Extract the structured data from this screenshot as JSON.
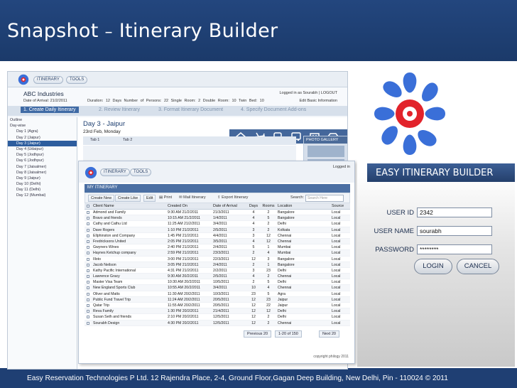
{
  "slide": {
    "title_prefix": "Snapshot",
    "title_dash": "–",
    "title_main": "Itinerary Builder",
    "footer": "Easy Reservation Technologies P Ltd. 12 Rajendra Place, 2-4, Ground Floor,Gagan Deep Building, New Delhi, Pin - 110024 © 2011"
  },
  "builder": {
    "menu": [
      "ITINERARY",
      "TOOLS"
    ],
    "company": "ABC Industries",
    "date_of_arrival": "Date of Arrival: 21/2/2011",
    "trip_info": "Duration: 12 Days   Number of Persons: 22   Single Room: 2   Double Room: 10   Twin Bed: 10",
    "logged_in": "Logged in as Sourabh | LOGOUT",
    "edit_basic": "Edit Basic Information",
    "steps": [
      "1. Create Daily Itinerary",
      "2. Review Itinerary",
      "3. Format Itinerary Document",
      "4. Specify Document Add-ons"
    ],
    "outline": [
      "Outline",
      "Day-wise",
      "Day 1 (Agra)",
      "Day 2 (Jaipur)",
      "Day 3 (Jaipur)",
      "Day 4 (Udaipur)",
      "Day 5 (Jodhpur)",
      "Day 6 (Jodhpur)",
      "Day 7 (Jaisalmer)",
      "Day 8 (Jaisalmer)",
      "Day 9 (Jaipur)",
      "Day 10 (Delhi)",
      "Day 11 (Delhi)",
      "Day 12 (Mumbai)"
    ],
    "day_title": "Day 3 - Jaipur",
    "day_date": "23rd Feb, Monday",
    "tabs": [
      "Tab 1",
      "Tab 2"
    ],
    "photo_gallery": "PHOTO GALLERY"
  },
  "list_window": {
    "menu": [
      "ITINERARY",
      "TOOLS"
    ],
    "logged_in": "Logged in",
    "header": "MY ITINERARY",
    "toolbar": [
      "Create New",
      "Create Like",
      "Edit"
    ],
    "links": [
      "Print",
      "Mail Itinerary",
      "Export Itinerary"
    ],
    "search_label": "Search:",
    "search_placeholder": "Search Here",
    "columns": [
      "Client Name",
      "Created On",
      "Date of Arrival",
      "Days",
      "Rooms",
      "Location",
      "Source"
    ],
    "rows": [
      [
        "Admond and Family",
        "9:30 AM 21/2/2011",
        "21/3/2011",
        "4",
        "2",
        "Bangalore",
        "Local"
      ],
      [
        "Bravo and friends",
        "10:15 AM 21/2/2011",
        "1/4/2011",
        "4",
        "5",
        "Bangalore",
        "Local"
      ],
      [
        "Cathy and Cathu Ltd",
        "11:25 AM 21/2/2011",
        "3/4/2011",
        "4",
        "2",
        "Delhi",
        "Local"
      ],
      [
        "Dave Rogers",
        "1:10 PM 21/2/2011",
        "2/5/2011",
        "3",
        "2",
        "Kolkata",
        "Local"
      ],
      [
        "Ellphinston and Company",
        "1:45 PM 21/2/2011",
        "4/4/2011",
        "3",
        "12",
        "Chennai",
        "Local"
      ],
      [
        "Fredricksons United",
        "2:05 PM 21/2/2011",
        "3/5/2011",
        "4",
        "12",
        "Chennai",
        "Local"
      ],
      [
        "Gwyners Wines",
        "2:40 PM 21/2/2011",
        "2/4/2011",
        "5",
        "1",
        "Mumbai",
        "Local"
      ],
      [
        "Haynes Ketchup company",
        "2:59 PM 21/2/2011",
        "23/3/2011",
        "2",
        "4",
        "Mumbai",
        "Local"
      ],
      [
        "Illoto",
        "3:00 PM 21/2/2011",
        "22/3/2011",
        "12",
        "3",
        "Bangalore",
        "Local"
      ],
      [
        "Jacob Neilson",
        "3:05 PM 21/2/2011",
        "2/4/2011",
        "2",
        "1",
        "Bangalore",
        "Local"
      ],
      [
        "Kathy Pacific International",
        "4:31 PM 21/2/2011",
        "2/2/2011",
        "3",
        "23",
        "Delhi",
        "Local"
      ],
      [
        "Lawrence Gracy",
        "9:30 AM 20/2/2011",
        "2/5/2011",
        "4",
        "2",
        "Chennai",
        "Local"
      ],
      [
        "Master Visa Team",
        "10:30 AM 20/2/2011",
        "10/5/2011",
        "2",
        "5",
        "Delhi",
        "Local"
      ],
      [
        "New England Sports Club",
        "10:55 AM 20/2/2011",
        "3/4/2011",
        "10",
        "4",
        "Chennai",
        "Local"
      ],
      [
        "Oliver and Matts",
        "11:30 AM 20/2/2011",
        "10/3/2011",
        "23",
        "5",
        "Agra",
        "Local"
      ],
      [
        "Public Fund Travel Trip",
        "11:24 AM 20/2/2011",
        "20/5/2011",
        "12",
        "23",
        "Jaipur",
        "Local"
      ],
      [
        "Qatar Trip",
        "11:55 AM 20/2/2011",
        "20/5/2011",
        "12",
        "22",
        "Jaipur",
        "Local"
      ],
      [
        "Reva Family",
        "1:30 PM 20/2/2011",
        "21/4/2011",
        "12",
        "12",
        "Delhi",
        "Local"
      ],
      [
        "Susan Seth and friends",
        "2:10 PM 20/2/2011",
        "12/5/2011",
        "12",
        "2",
        "Delhi",
        "Local"
      ],
      [
        "Sourabh Design",
        "4:30 PM 20/2/2011",
        "12/5/2011",
        "12",
        "2",
        "Chennai",
        "Local"
      ]
    ],
    "pager": {
      "previous": "Previous 20",
      "range": "1-20 of 150",
      "next": "Next 20"
    },
    "copyright": "copyright philogy 2011"
  },
  "login": {
    "banner": "EASY ITINERARY BUILDER",
    "user_id_label": "USER ID",
    "user_id_value": "2342",
    "user_name_label": "USER NAME",
    "user_name_value": "sourabh",
    "password_label": "PASSWORD",
    "password_value": "********",
    "login_button": "LOGIN",
    "cancel_button": "CANCEL"
  },
  "colors": {
    "slide_blue": "#1f3f73",
    "app_blue": "#3f6aa5",
    "logo_blue": "#3a6fd8",
    "logo_red": "#e2232b"
  },
  "icons": [
    "home-icon",
    "flight-icon",
    "train-icon",
    "bus-icon",
    "hotel-icon",
    "car-icon",
    "print-icon",
    "mail-icon",
    "export-icon",
    "logo-icon"
  ]
}
